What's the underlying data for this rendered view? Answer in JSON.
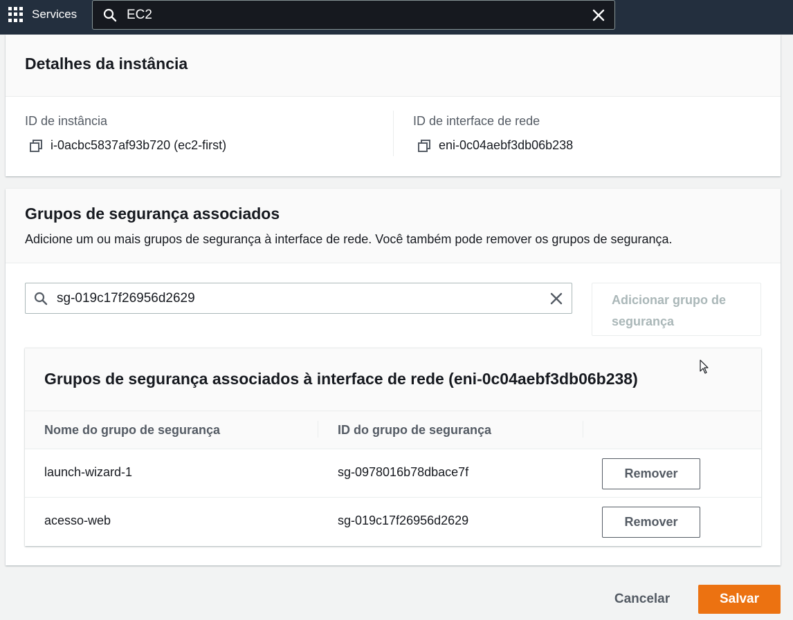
{
  "topnav": {
    "services_label": "Services",
    "search_value": "EC2"
  },
  "instance_details": {
    "title": "Detalhes da instância",
    "instance_id_label": "ID de instância",
    "instance_id_value": "i-0acbc5837af93b720 (ec2-first)",
    "eni_label": "ID de interface de rede",
    "eni_value": "eni-0c04aebf3db06b238"
  },
  "security_groups": {
    "title": "Grupos de segurança associados",
    "description": "Adicione um ou mais grupos de segurança à interface de rede. Você também pode remover os grupos de segurança.",
    "filter_value": "sg-019c17f26956d2629",
    "add_button_label": "Adicionar grupo de segurança",
    "table": {
      "title": "Grupos de segurança associados à interface de rede (eni-0c04aebf3db06b238)",
      "columns": [
        "Nome do grupo de segurança",
        "ID do grupo de segurança"
      ],
      "rows": [
        {
          "name": "launch-wizard-1",
          "id": "sg-0978016b78dbace7f",
          "action": "Remover"
        },
        {
          "name": "acesso-web",
          "id": "sg-019c17f26956d2629",
          "action": "Remover"
        }
      ]
    }
  },
  "footer": {
    "cancel_label": "Cancelar",
    "save_label": "Salvar"
  },
  "colors": {
    "nav_bg": "#232f3e",
    "primary_button": "#ec7211"
  }
}
